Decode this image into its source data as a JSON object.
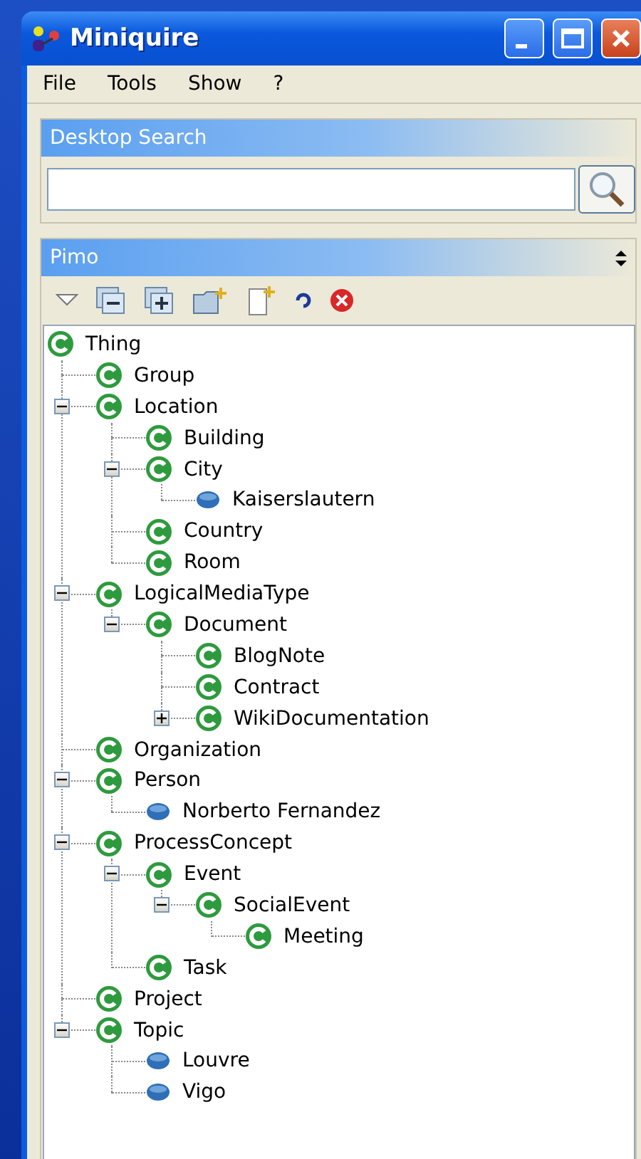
{
  "window": {
    "title": "Miniquire"
  },
  "menu": [
    "File",
    "Tools",
    "Show",
    "?"
  ],
  "search_panel": {
    "title": "Desktop Search"
  },
  "pimo_panel": {
    "title": "Pimo"
  },
  "tree": {
    "label": "Thing",
    "kind": "class",
    "children": [
      {
        "label": "Group",
        "kind": "class"
      },
      {
        "label": "Location",
        "kind": "class",
        "expanded": true,
        "children": [
          {
            "label": "Building",
            "kind": "class"
          },
          {
            "label": "City",
            "kind": "class",
            "expanded": true,
            "children": [
              {
                "label": "Kaiserslautern",
                "kind": "instance"
              }
            ]
          },
          {
            "label": "Country",
            "kind": "class"
          },
          {
            "label": "Room",
            "kind": "class"
          }
        ]
      },
      {
        "label": "LogicalMediaType",
        "kind": "class",
        "expanded": true,
        "children": [
          {
            "label": "Document",
            "kind": "class",
            "expanded": true,
            "children": [
              {
                "label": "BlogNote",
                "kind": "class"
              },
              {
                "label": "Contract",
                "kind": "class"
              },
              {
                "label": "WikiDocumentation",
                "kind": "class",
                "expanded": false
              }
            ]
          }
        ]
      },
      {
        "label": "Organization",
        "kind": "class"
      },
      {
        "label": "Person",
        "kind": "class",
        "expanded": true,
        "children": [
          {
            "label": "Norberto Fernandez",
            "kind": "instance"
          }
        ]
      },
      {
        "label": "ProcessConcept",
        "kind": "class",
        "expanded": true,
        "children": [
          {
            "label": "Event",
            "kind": "class",
            "expanded": true,
            "children": [
              {
                "label": "SocialEvent",
                "kind": "class",
                "expanded": true,
                "children": [
                  {
                    "label": "Meeting",
                    "kind": "class"
                  }
                ]
              }
            ]
          },
          {
            "label": "Task",
            "kind": "class"
          }
        ]
      },
      {
        "label": "Project",
        "kind": "class"
      },
      {
        "label": "Topic",
        "kind": "class",
        "expanded": true,
        "children": [
          {
            "label": "Louvre",
            "kind": "instance"
          },
          {
            "label": "Vigo",
            "kind": "instance"
          }
        ]
      }
    ]
  }
}
